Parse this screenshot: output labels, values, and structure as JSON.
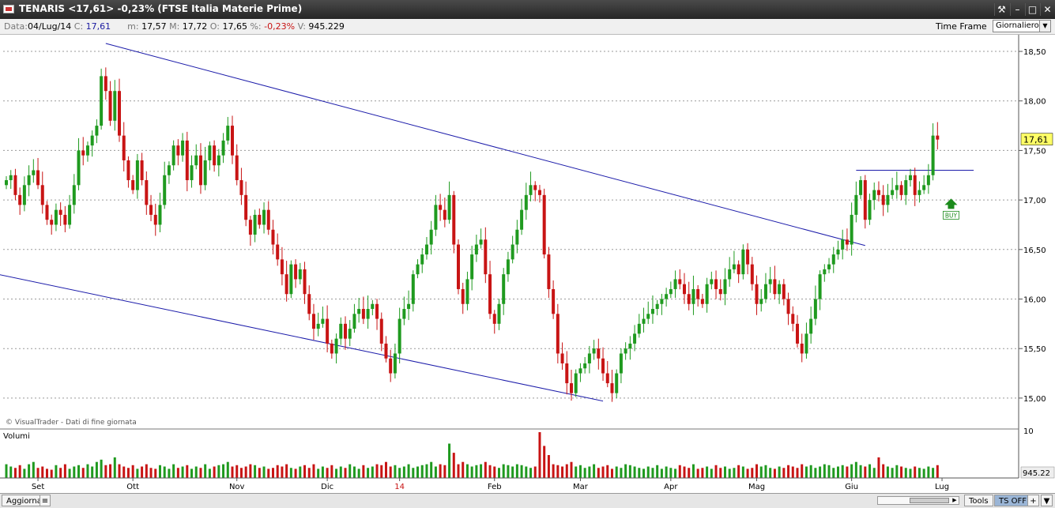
{
  "window": {
    "title": "TENARIS <17,61> -0,23%  (FTSE Italia Materie Prime)",
    "tools_icon": "wrench-icon",
    "min_icon": "minimize-icon",
    "max_icon": "maximize-icon",
    "close_icon": "close-icon"
  },
  "info": {
    "data_label": "Data:",
    "data_value": "04/Lug/14",
    "c_label": "C:",
    "c_value": "17,61",
    "m_label": "m:",
    "m_value": "17,57",
    "M_label": "M:",
    "M_value": "17,72",
    "o_label": "O:",
    "o_value": "17,65",
    "pct_label": "%:",
    "pct_value": "-0,23%",
    "v_label": "V:",
    "v_value": "945.229",
    "timeframe_label": "Time Frame",
    "timeframe_value": "Giornaliero"
  },
  "colors": {
    "up": "#1f9a1f",
    "down": "#c81414",
    "trendline": "#1c1caa",
    "grid": "#9a9a9a",
    "last_price_bg": "#ffff66"
  },
  "chart_data": {
    "type": "candlestick",
    "copyright": "© VisualTrader - Dati di fine giornata",
    "last_price_label": "17,61",
    "signal_label": "BUY",
    "volume_label": "Volumi",
    "volume_axis_label": "10",
    "last_volume_label": "945.22",
    "y_ticks": [
      "18,50",
      "18,00",
      "17,50",
      "17,00",
      "16,50",
      "16,00",
      "15,50",
      "15,00"
    ],
    "y_tick_values": [
      18.5,
      18.0,
      17.5,
      17.0,
      16.5,
      16.0,
      15.5,
      15.0
    ],
    "ylim": [
      14.68,
      18.62
    ],
    "x_labels": [
      {
        "label": "Set",
        "index": 7,
        "red": false
      },
      {
        "label": "Ott",
        "index": 28,
        "red": false
      },
      {
        "label": "Nov",
        "index": 51,
        "red": false
      },
      {
        "label": "Dic",
        "index": 71,
        "red": false
      },
      {
        "label": "14",
        "index": 87,
        "red": true
      },
      {
        "label": "Feb",
        "index": 108,
        "red": false
      },
      {
        "label": "Mar",
        "index": 127,
        "red": false
      },
      {
        "label": "Apr",
        "index": 147,
        "red": false
      },
      {
        "label": "Mag",
        "index": 166,
        "red": false
      },
      {
        "label": "Giu",
        "index": 187,
        "red": false
      },
      {
        "label": "Lug",
        "index": 207,
        "red": false
      }
    ],
    "closes": [
      17.2,
      17.25,
      17.05,
      16.95,
      17.15,
      17.25,
      17.3,
      17.15,
      16.95,
      16.8,
      16.75,
      16.9,
      16.85,
      16.75,
      16.95,
      17.15,
      17.5,
      17.45,
      17.55,
      17.65,
      17.75,
      18.25,
      18.1,
      17.8,
      18.1,
      17.65,
      17.4,
      17.2,
      17.1,
      17.4,
      17.2,
      16.95,
      16.85,
      16.75,
      16.95,
      17.25,
      17.35,
      17.55,
      17.45,
      17.6,
      17.2,
      17.35,
      17.45,
      17.15,
      17.4,
      17.55,
      17.35,
      17.45,
      17.6,
      17.75,
      17.45,
      17.2,
      17.05,
      16.8,
      16.65,
      16.85,
      16.75,
      16.9,
      16.7,
      16.55,
      16.4,
      16.25,
      16.05,
      16.35,
      16.2,
      16.3,
      16.05,
      15.85,
      15.7,
      15.75,
      15.8,
      15.55,
      15.45,
      15.6,
      15.75,
      15.6,
      15.7,
      15.85,
      15.9,
      15.8,
      15.9,
      15.95,
      15.8,
      15.55,
      15.4,
      15.25,
      15.45,
      15.8,
      15.9,
      15.95,
      16.25,
      16.35,
      16.45,
      16.55,
      16.7,
      16.95,
      16.9,
      16.8,
      17.05,
      16.55,
      16.1,
      15.95,
      16.2,
      16.45,
      16.55,
      16.6,
      16.25,
      15.85,
      15.75,
      15.95,
      16.25,
      16.4,
      16.55,
      16.7,
      16.9,
      17.05,
      17.15,
      17.1,
      17.05,
      16.45,
      16.1,
      15.85,
      15.45,
      15.35,
      15.15,
      15.05,
      15.25,
      15.3,
      15.35,
      15.45,
      15.5,
      15.4,
      15.25,
      15.15,
      15.05,
      15.25,
      15.45,
      15.5,
      15.55,
      15.65,
      15.75,
      15.8,
      15.85,
      15.9,
      15.95,
      16.0,
      16.05,
      16.1,
      16.2,
      16.15,
      16.05,
      15.95,
      16.1,
      16.0,
      15.95,
      16.15,
      16.2,
      16.1,
      16.05,
      16.2,
      16.3,
      16.35,
      16.25,
      16.5,
      16.35,
      16.15,
      15.95,
      16.0,
      16.15,
      16.2,
      16.05,
      16.15,
      16.0,
      15.85,
      15.75,
      15.55,
      15.45,
      15.65,
      15.8,
      16.0,
      16.25,
      16.3,
      16.35,
      16.45,
      16.5,
      16.6,
      16.55,
      16.85,
      17.05,
      17.2,
      16.8,
      17.0,
      17.1,
      17.05,
      16.95,
      17.05,
      17.1,
      17.15,
      17.05,
      17.2,
      17.25,
      17.05,
      17.1,
      17.15,
      17.25,
      17.65,
      17.61
    ],
    "volumes": [
      0.3,
      0.25,
      0.22,
      0.28,
      0.2,
      0.3,
      0.35,
      0.22,
      0.25,
      0.2,
      0.18,
      0.28,
      0.22,
      0.3,
      0.2,
      0.25,
      0.28,
      0.22,
      0.3,
      0.25,
      0.35,
      0.4,
      0.28,
      0.3,
      0.45,
      0.3,
      0.25,
      0.22,
      0.28,
      0.2,
      0.25,
      0.3,
      0.22,
      0.2,
      0.28,
      0.25,
      0.2,
      0.3,
      0.22,
      0.25,
      0.28,
      0.2,
      0.25,
      0.22,
      0.3,
      0.2,
      0.25,
      0.28,
      0.3,
      0.35,
      0.25,
      0.28,
      0.22,
      0.25,
      0.3,
      0.28,
      0.22,
      0.25,
      0.2,
      0.22,
      0.28,
      0.25,
      0.3,
      0.22,
      0.2,
      0.25,
      0.28,
      0.22,
      0.3,
      0.2,
      0.25,
      0.22,
      0.28,
      0.2,
      0.25,
      0.22,
      0.3,
      0.25,
      0.2,
      0.28,
      0.22,
      0.25,
      0.3,
      0.28,
      0.35,
      0.25,
      0.28,
      0.22,
      0.25,
      0.3,
      0.22,
      0.25,
      0.28,
      0.3,
      0.35,
      0.25,
      0.3,
      0.28,
      0.75,
      0.55,
      0.3,
      0.35,
      0.3,
      0.25,
      0.28,
      0.3,
      0.35,
      0.28,
      0.25,
      0.22,
      0.3,
      0.28,
      0.25,
      0.3,
      0.28,
      0.25,
      0.22,
      0.25,
      1.0,
      0.7,
      0.5,
      0.3,
      0.28,
      0.25,
      0.3,
      0.35,
      0.25,
      0.28,
      0.22,
      0.25,
      0.3,
      0.22,
      0.25,
      0.28,
      0.2,
      0.25,
      0.22,
      0.3,
      0.28,
      0.25,
      0.22,
      0.2,
      0.25,
      0.22,
      0.28,
      0.2,
      0.25,
      0.22,
      0.2,
      0.28,
      0.25,
      0.22,
      0.3,
      0.2,
      0.22,
      0.25,
      0.2,
      0.28,
      0.22,
      0.25,
      0.2,
      0.22,
      0.28,
      0.25,
      0.2,
      0.22,
      0.3,
      0.25,
      0.28,
      0.22,
      0.2,
      0.25,
      0.22,
      0.28,
      0.25,
      0.22,
      0.3,
      0.25,
      0.28,
      0.22,
      0.25,
      0.3,
      0.28,
      0.22,
      0.25,
      0.28,
      0.25,
      0.3,
      0.35,
      0.28,
      0.25,
      0.3,
      0.22,
      0.45,
      0.3,
      0.25,
      0.22,
      0.28,
      0.25,
      0.22,
      0.2,
      0.25,
      0.22,
      0.2,
      0.25,
      0.22,
      0.28,
      0.2,
      0.25,
      0.35,
      0.28
    ],
    "trendlines": [
      {
        "name": "upper-channel",
        "x1": 22.0,
        "y1": 18.58,
        "x2": 190.0,
        "y2": 16.54
      },
      {
        "name": "lower-channel",
        "x1": -5.0,
        "y1": 16.28,
        "x2": 132.0,
        "y2": 14.97
      },
      {
        "name": "resistance",
        "x1": 188.0,
        "y1": 17.3,
        "x2": 214.0,
        "y2": 17.3
      }
    ],
    "buy_signal_index": 209,
    "buy_signal_price": 16.95
  },
  "bottom": {
    "refresh_label": "Aggiorna",
    "tools_label": "Tools",
    "ts_label": "TS OFF",
    "plus_label": "+",
    "menu_icon": "menu-icon"
  }
}
